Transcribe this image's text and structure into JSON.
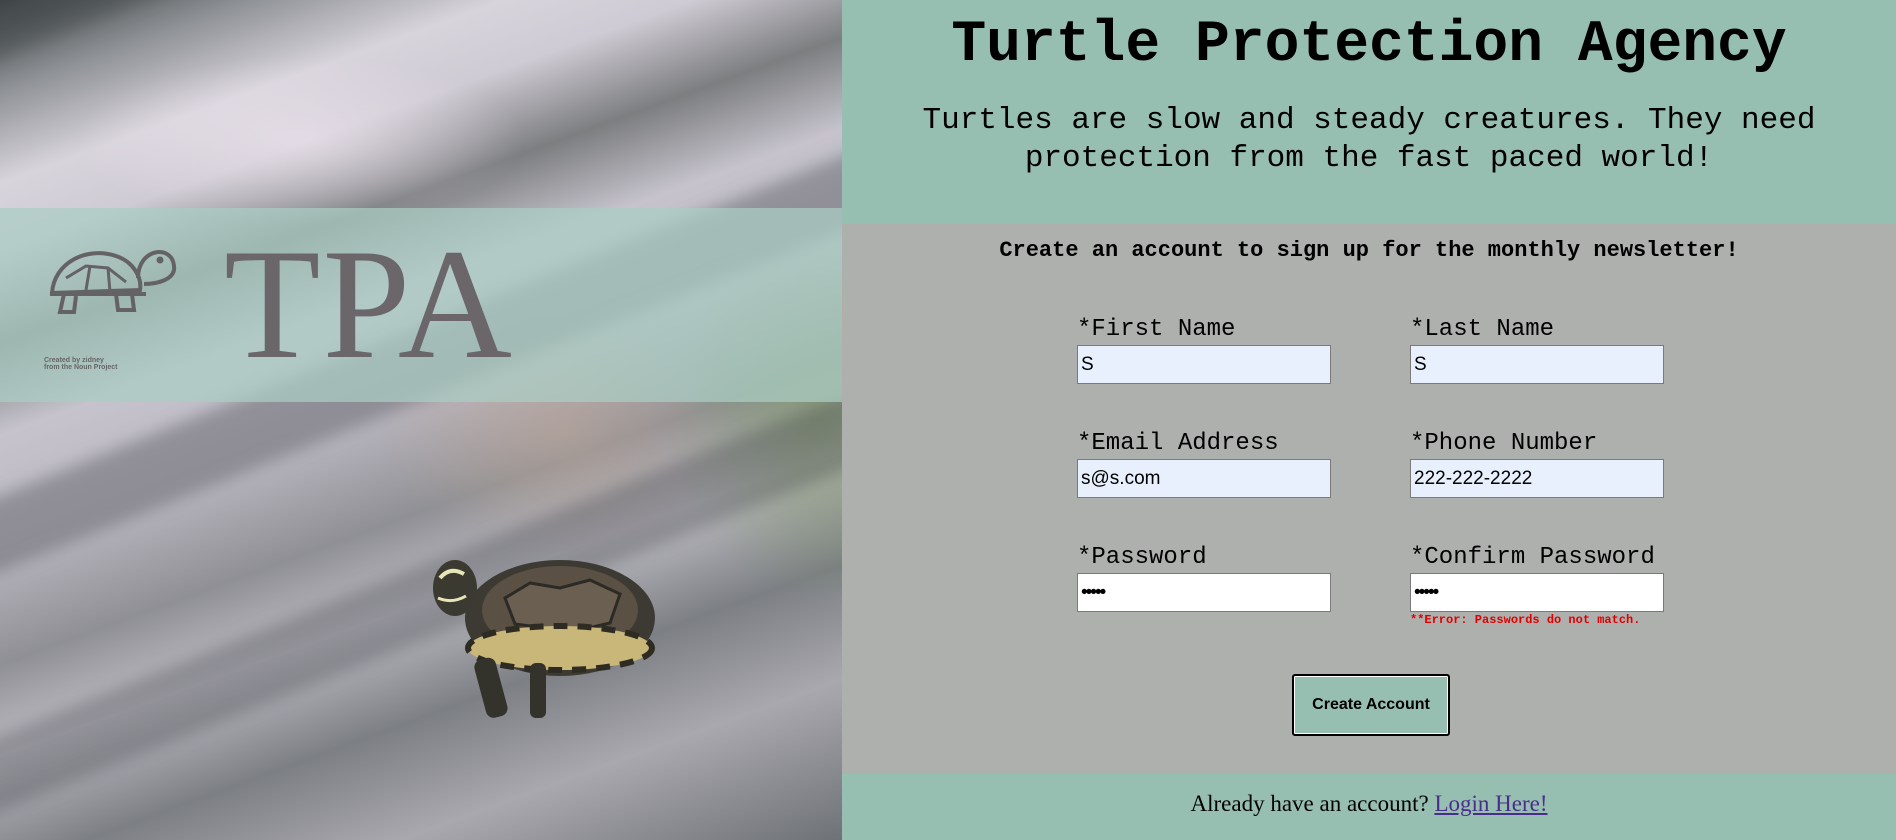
{
  "logo": {
    "text": "TPA",
    "credit_line1": "Created by zidney",
    "credit_line2": "from the Noun Project",
    "icon": "turtle-icon"
  },
  "header": {
    "title": "Turtle Protection Agency",
    "tagline": "Turtles are slow and steady creatures. They need protection from the fast paced world!"
  },
  "form": {
    "heading": "Create an account to sign up for the monthly newsletter!",
    "first_name": {
      "label": "*First Name",
      "value": "S"
    },
    "last_name": {
      "label": "*Last Name",
      "value": "S"
    },
    "email": {
      "label": "*Email Address",
      "value": "s@s.com"
    },
    "phone": {
      "label": "*Phone Number",
      "value": "222-222-2222"
    },
    "password": {
      "label": "*Password",
      "value": "•••••"
    },
    "confirm_password": {
      "label": "*Confirm Password",
      "value": "•••••"
    },
    "error": "**Error: Passwords do not match.",
    "submit_label": "Create Account"
  },
  "footer": {
    "text": "Already have an account?",
    "link": "Login Here!"
  },
  "colors": {
    "teal": "#97bfb1",
    "gray": "#aeb0ae",
    "error": "#e00000",
    "autofill": "#e8f0fe"
  }
}
